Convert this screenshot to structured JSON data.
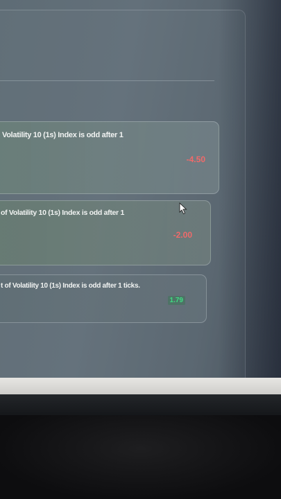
{
  "transactions": [
    {
      "text": "Volatility 10 (1s) Index is odd after 1",
      "amount": "-4.50",
      "status": "loss"
    },
    {
      "text": "of Volatility 10 (1s) Index is odd after 1",
      "amount": "-2.00",
      "status": "loss"
    },
    {
      "text": "t of Volatility 10 (1s) Index is odd after 1 ticks.",
      "amount": "1.79",
      "status": "profit"
    }
  ],
  "colors": {
    "loss": "#f06a6a",
    "profit": "#3fdc82"
  },
  "icons": {
    "pointer": "mouse-pointer-icon"
  }
}
